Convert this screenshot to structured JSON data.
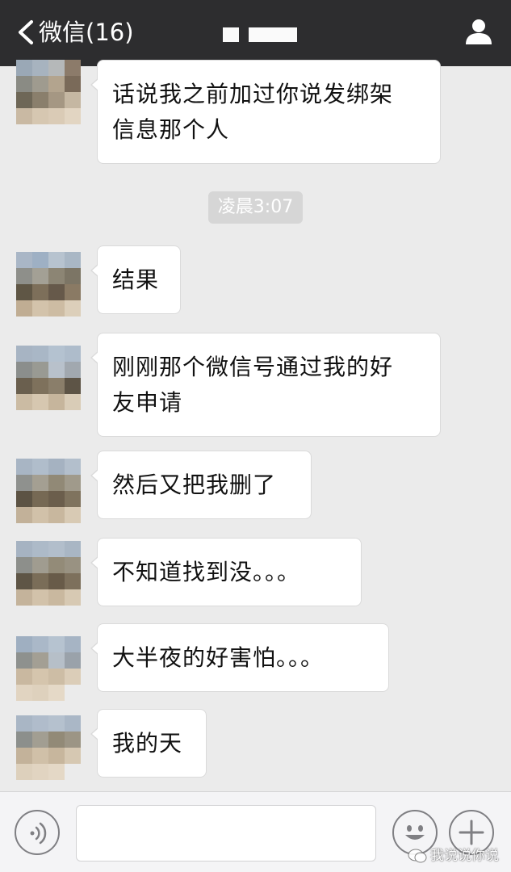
{
  "header": {
    "back_label": "微信(16)",
    "title_redacted": true,
    "icons": {
      "back": "chevron-left-icon",
      "profile": "person-icon"
    },
    "background": "#2d2d2f"
  },
  "timestamp": "凌晨3:07",
  "messages": [
    {
      "sender": "other",
      "text_lines": [
        "话说我之前加过你说发绑架",
        "信息那个人"
      ]
    },
    {
      "sender": "other",
      "text_lines": [
        "结果"
      ]
    },
    {
      "sender": "other",
      "text_lines": [
        "刚刚那个微信号通过我的好",
        "友申请"
      ]
    },
    {
      "sender": "other",
      "text_lines": [
        "然后又把我删了"
      ]
    },
    {
      "sender": "other",
      "text_lines": [
        "不知道找到没。。。"
      ]
    },
    {
      "sender": "other",
      "text_lines": [
        "大半夜的好害怕。。。"
      ]
    },
    {
      "sender": "other",
      "text_lines": [
        "我的天"
      ]
    }
  ],
  "input_bar": {
    "text_value": "",
    "icons": {
      "voice": "voice-icon",
      "emoji": "emoji-icon",
      "more": "plus-icon"
    }
  },
  "watermark": {
    "text": "我说说你说",
    "icon": "watermark-logo-icon"
  },
  "colors": {
    "chat_bg": "#ebebeb",
    "bubble": "#ffffff",
    "timestamp_bg": "#d6d6d6"
  }
}
